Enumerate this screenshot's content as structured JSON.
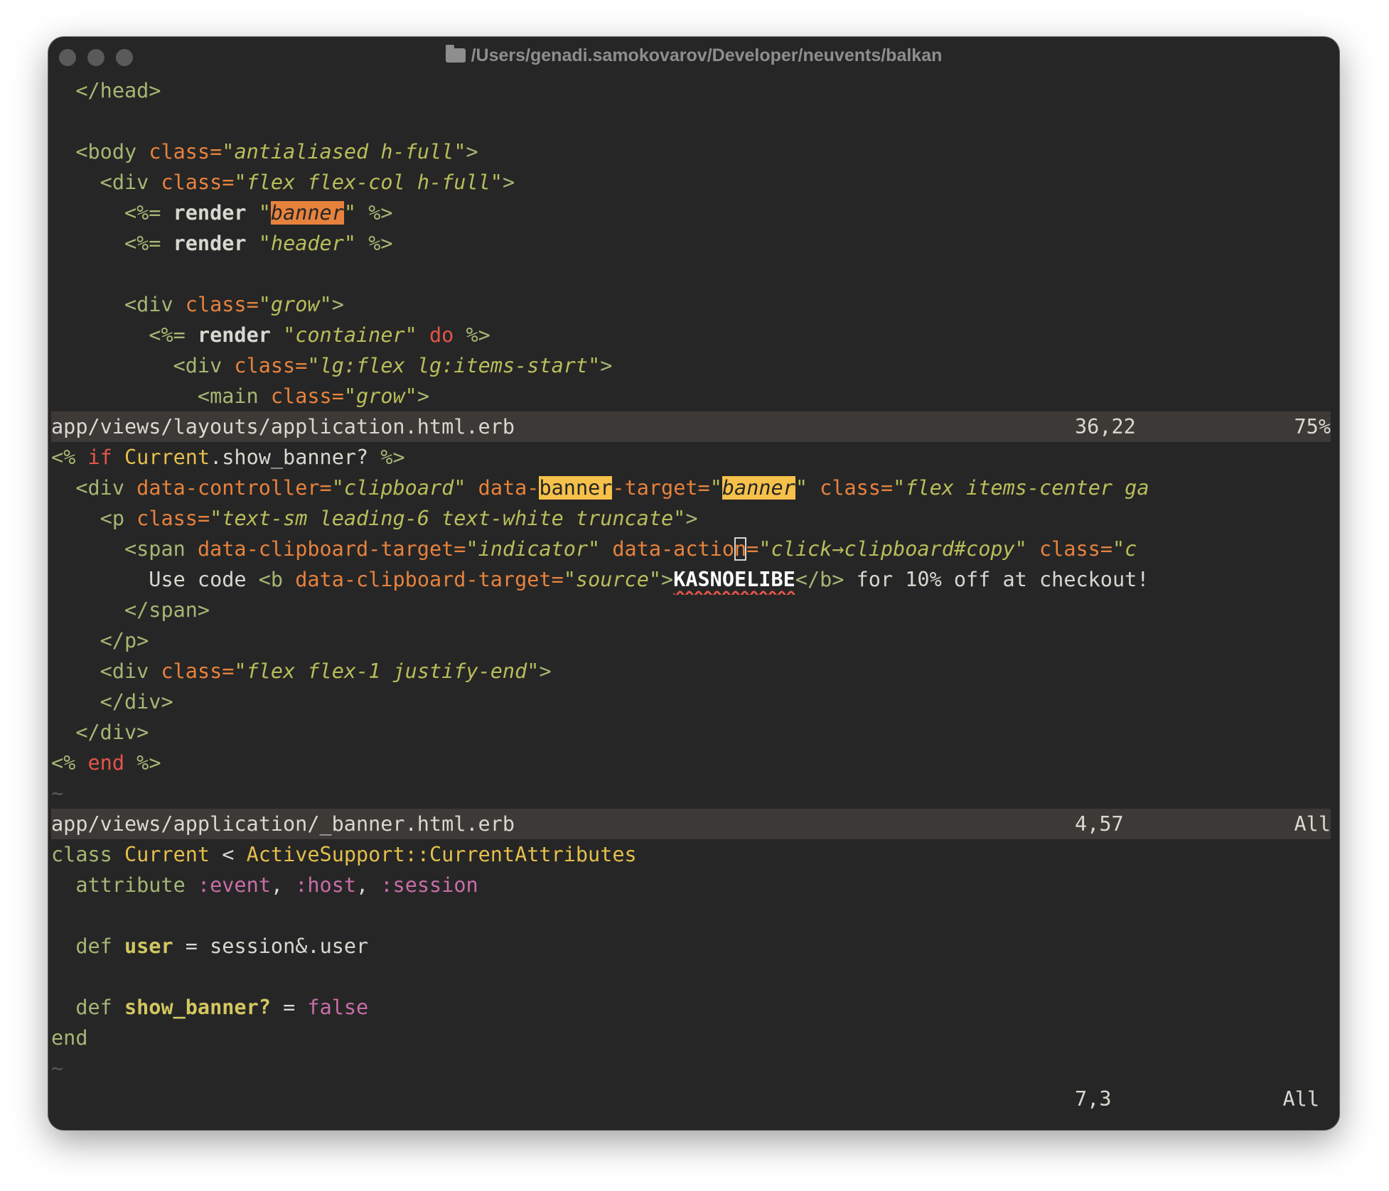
{
  "window": {
    "title": "/Users/genadi.samokovarov/Developer/neuvents/balkan",
    "icon": "folder-icon"
  },
  "pane1": {
    "lines": {
      "l1": [
        "</",
        "head",
        ">"
      ],
      "l3": [
        "<",
        "body",
        "class",
        "=",
        "\"",
        "antialiased h-full",
        "\"",
        ">"
      ],
      "l4": [
        "<",
        "div",
        "class",
        "=",
        "\"",
        "flex flex-col h-full",
        "\"",
        ">"
      ],
      "l5": [
        "<%=",
        "render",
        "\"",
        "banner",
        "\"",
        "%>"
      ],
      "l6": [
        "<%=",
        "render",
        "\"",
        "header",
        "\"",
        "%>"
      ],
      "l8": [
        "<",
        "div",
        "class",
        "=",
        "\"",
        "grow",
        "\"",
        ">"
      ],
      "l9": [
        "<%=",
        "render",
        "\"",
        "container",
        "\"",
        "do",
        "%>"
      ],
      "l10": [
        "<",
        "div",
        "class",
        "=",
        "\"",
        "lg:flex lg:items-start",
        "\"",
        ">"
      ],
      "l11": [
        "<",
        "main",
        "class",
        "=",
        "\"",
        "grow",
        "\"",
        ">"
      ]
    },
    "status": {
      "file": "app/views/layouts/application.html.erb",
      "position": "36,22",
      "percent": "75%"
    }
  },
  "pane2": {
    "lines": {
      "l1": [
        "<%",
        "if",
        "Current",
        ".show_banner?",
        "%>"
      ],
      "l2": [
        "<",
        "div",
        "data-controller",
        "=",
        "\"",
        "clipboard",
        "\"",
        "data-",
        "banner",
        "-target",
        "=",
        "\"",
        "banner",
        "\"",
        "class",
        "=",
        "\"",
        "flex items-center ga"
      ],
      "l3": [
        "<",
        "p",
        "class",
        "=",
        "\"",
        "text-sm leading-6 text-white truncate",
        "\"",
        ">"
      ],
      "l4": [
        "<",
        "span",
        "data-clipboard-target",
        "=",
        "\"",
        "indicator",
        "\"",
        "data-actio",
        "n",
        "=",
        "\"",
        "click→clipboard#copy",
        "\"",
        "class",
        "=",
        "\"",
        "c"
      ],
      "l5": [
        "Use code ",
        "<",
        "b",
        "data-clipboard-target",
        "=",
        "\"",
        "source",
        "\"",
        ">",
        "KASNOELIBE",
        "</",
        "b",
        ">",
        " for 10% off at checkout!"
      ],
      "l6": [
        "</",
        "span",
        ">"
      ],
      "l7": [
        "</",
        "p",
        ">"
      ],
      "l8": [
        "<",
        "div",
        "class",
        "=",
        "\"",
        "flex flex-1 justify-end",
        "\"",
        ">"
      ],
      "l9": [
        "</",
        "div",
        ">"
      ],
      "l10": [
        "</",
        "div",
        ">"
      ],
      "l11": [
        "<%",
        "end",
        "%>"
      ],
      "tilde": "~"
    },
    "status": {
      "file": "app/views/application/_banner.html.erb",
      "position": "4,57",
      "percent": "All"
    }
  },
  "pane3": {
    "lines": {
      "l1": [
        "class",
        "Current",
        "<",
        "ActiveSupport",
        "::",
        "CurrentAttributes"
      ],
      "l2": [
        "attribute",
        ":event",
        ",",
        ":host",
        ",",
        ":session"
      ],
      "l4": [
        "def",
        "user",
        "=",
        "session&.user"
      ],
      "l6": [
        "def",
        "show_banner?",
        "=",
        "false"
      ],
      "l7": [
        "end"
      ],
      "tilde": "~"
    },
    "status": {
      "position": "7,3",
      "percent": "All"
    }
  },
  "colors": {
    "background": "#262626",
    "status_bar": "#3d3936",
    "tag": "#a5b774",
    "attribute": "#e7823d",
    "string": "#b8be5a",
    "keyword": "#e4554a",
    "type": "#e5bf4c",
    "symbol": "#c86ea8",
    "search_highlight": "#f5c14a",
    "current_match": "#e7823d"
  }
}
